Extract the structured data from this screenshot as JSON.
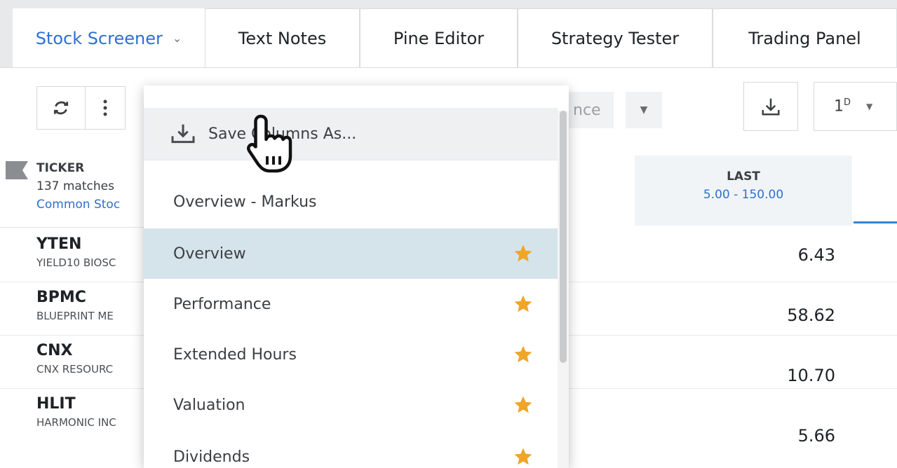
{
  "tabs": [
    {
      "label": "Stock Screener",
      "active": true
    },
    {
      "label": "Text Notes"
    },
    {
      "label": "Pine Editor"
    },
    {
      "label": "Strategy Tester"
    },
    {
      "label": "Trading Panel"
    }
  ],
  "toolbar": {
    "filter_stub": "nce",
    "interval": "1",
    "interval_sup": "D"
  },
  "table": {
    "ticker_header": "TICKER",
    "matches": "137 matches",
    "filter_type": "Common Stoc",
    "last_header": "LAST",
    "last_range": "5.00 - 150.00",
    "rows": [
      {
        "symbol": "YTEN",
        "name": "YIELD10 BIOSC",
        "last": "6.43"
      },
      {
        "symbol": "BPMC",
        "name": "BLUEPRINT ME",
        "last": "58.62"
      },
      {
        "symbol": "CNX",
        "name": "CNX RESOURC",
        "last": "10.70"
      },
      {
        "symbol": "HLIT",
        "name": "HARMONIC INC",
        "last": "5.66"
      }
    ]
  },
  "dropdown": {
    "save_label": "Save Columns As...",
    "items": [
      {
        "label": "Overview - Markus",
        "starred": false
      },
      {
        "label": "Overview",
        "starred": true,
        "active": true
      },
      {
        "label": "Performance",
        "starred": true
      },
      {
        "label": "Extended Hours",
        "starred": true
      },
      {
        "label": "Valuation",
        "starred": true
      },
      {
        "label": "Dividends",
        "starred": true
      }
    ]
  },
  "colors": {
    "accent": "#2f6fd1",
    "star": "#f0a526",
    "active_item_bg": "#d5e4ea"
  }
}
